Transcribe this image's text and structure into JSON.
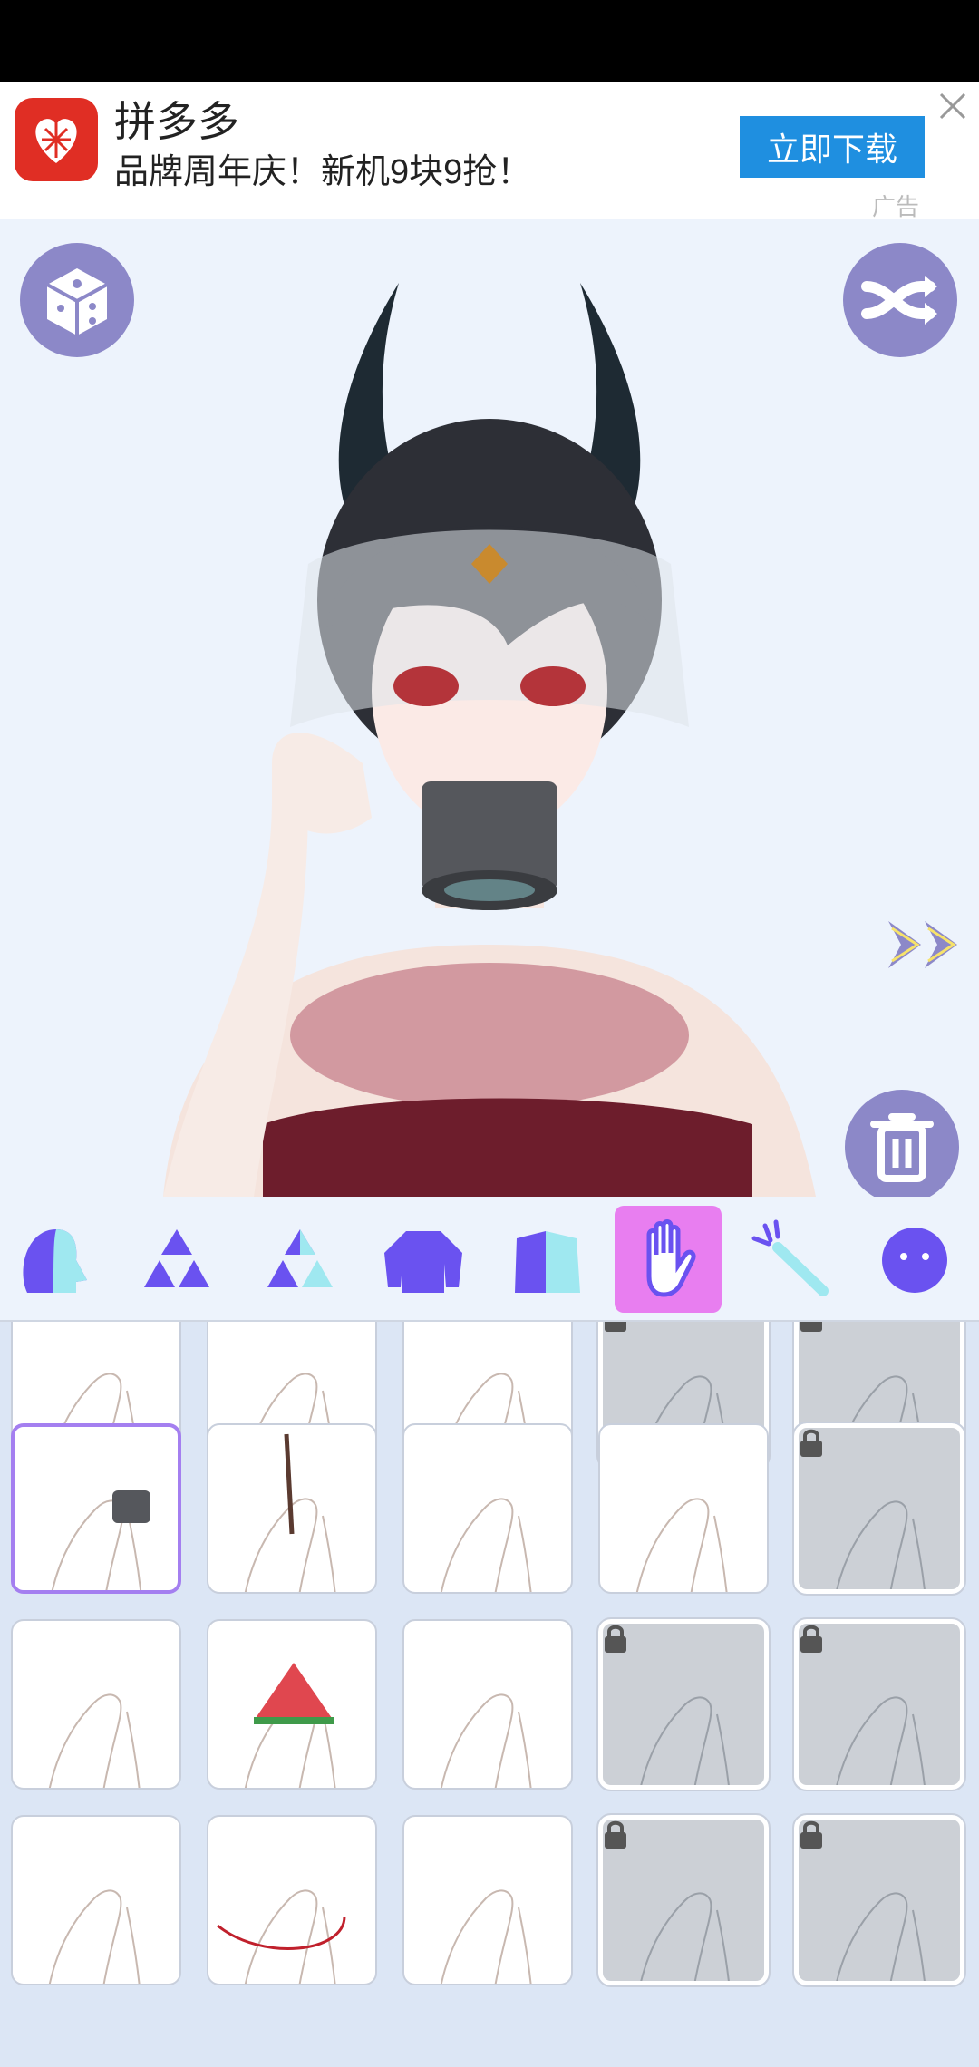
{
  "ad": {
    "app_name": "拼多多",
    "subtitle": "品牌周年庆！新机9块9抢！",
    "download_button": "立即下载",
    "ad_label": "广告"
  },
  "toolbar": {
    "random_icon": "dice-icon",
    "shuffle_icon": "shuffle-icon",
    "next_icon": "double-chevron-right-icon",
    "delete_icon": "trash-icon"
  },
  "category_tabs": [
    {
      "icon": "head-icon",
      "active": false
    },
    {
      "icon": "triangles-icon",
      "active": false
    },
    {
      "icon": "triangles-alt-icon",
      "active": false
    },
    {
      "icon": "shirt-icon",
      "active": false
    },
    {
      "icon": "outfit-icon",
      "active": false
    },
    {
      "icon": "hand-icon",
      "active": true
    },
    {
      "icon": "wand-icon",
      "active": false
    },
    {
      "icon": "face-icon",
      "active": false
    }
  ],
  "hand_items": [
    {
      "name": "hands-row0-1",
      "locked": false
    },
    {
      "name": "hands-row0-2",
      "locked": false
    },
    {
      "name": "hands-row0-3",
      "locked": false
    },
    {
      "name": "hands-row0-4",
      "locked": true
    },
    {
      "name": "hands-row0-5",
      "locked": true
    },
    {
      "name": "hand-teacup",
      "locked": false,
      "selected": true
    },
    {
      "name": "hand-wand",
      "locked": false
    },
    {
      "name": "hand-pointing-up",
      "locked": false
    },
    {
      "name": "hand-thumbs-up",
      "locked": false
    },
    {
      "name": "hands-praying",
      "locked": true
    },
    {
      "name": "hands-clasped",
      "locked": false
    },
    {
      "name": "hands-watermelon",
      "locked": false
    },
    {
      "name": "hand-ok-sign",
      "locked": false
    },
    {
      "name": "hands-bandaged",
      "locked": true
    },
    {
      "name": "hands-rock-sign",
      "locked": true
    },
    {
      "name": "hand-pinch",
      "locked": false
    },
    {
      "name": "hand-red-string",
      "locked": false
    },
    {
      "name": "hands-raised",
      "locked": false
    },
    {
      "name": "hands-claws",
      "locked": true
    },
    {
      "name": "hands-string-game",
      "locked": true
    }
  ],
  "colors": {
    "accent": "#8c88c8",
    "tab_icon": "#6a52f0",
    "tab_active": "#e87ef0",
    "ad_button": "#1f8fe0",
    "selected_border": "#a47ff0"
  }
}
